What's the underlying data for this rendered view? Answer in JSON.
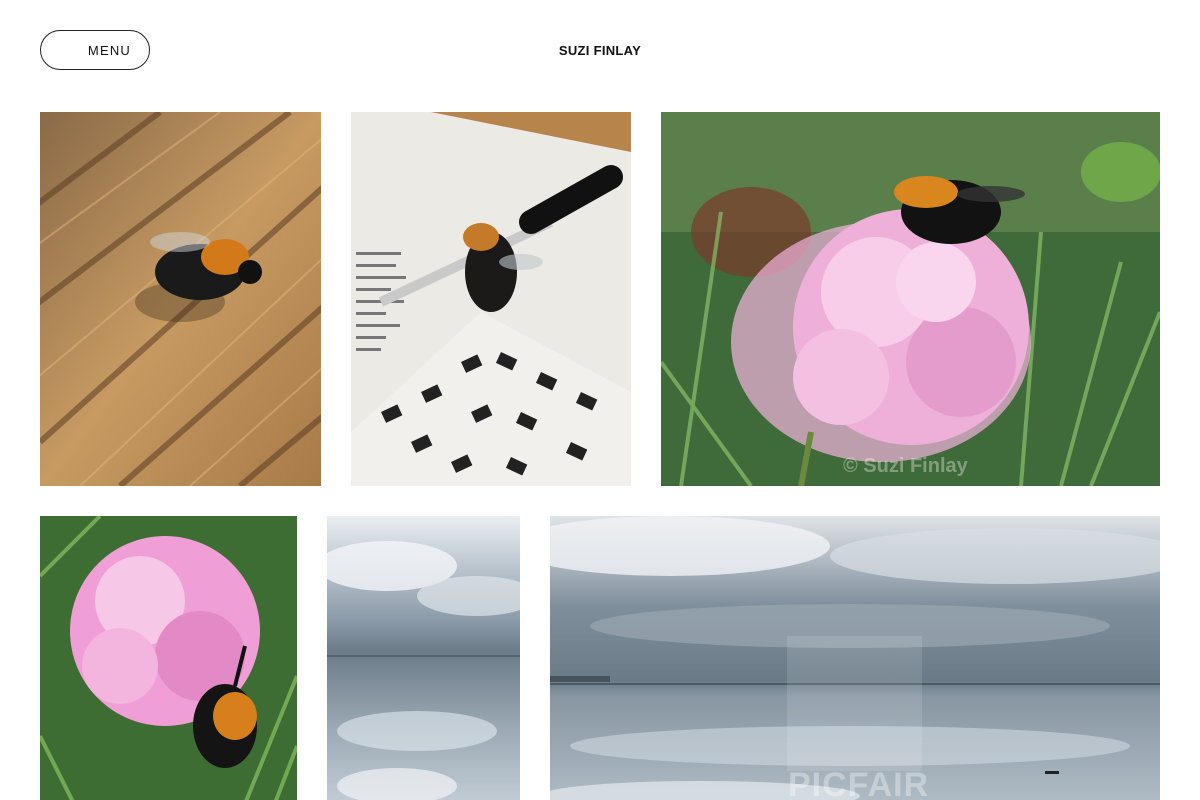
{
  "header": {
    "menu_label": "MENU",
    "site_title": "SUZI FINLAY"
  },
  "gallery": {
    "tiles": [
      {
        "subject": "bumblebee on wooden decking"
      },
      {
        "subject": "bumblebee on pen and crossword puzzle"
      },
      {
        "subject": "bumblebee on pink carnation",
        "watermark": "© Suzi Finlay"
      },
      {
        "subject": "pink carnation with bumblebee"
      },
      {
        "subject": "cloudy sky reflected in calm water"
      },
      {
        "subject": "cloudy sky over calm sea",
        "watermark": "PICFAIR"
      }
    ]
  }
}
